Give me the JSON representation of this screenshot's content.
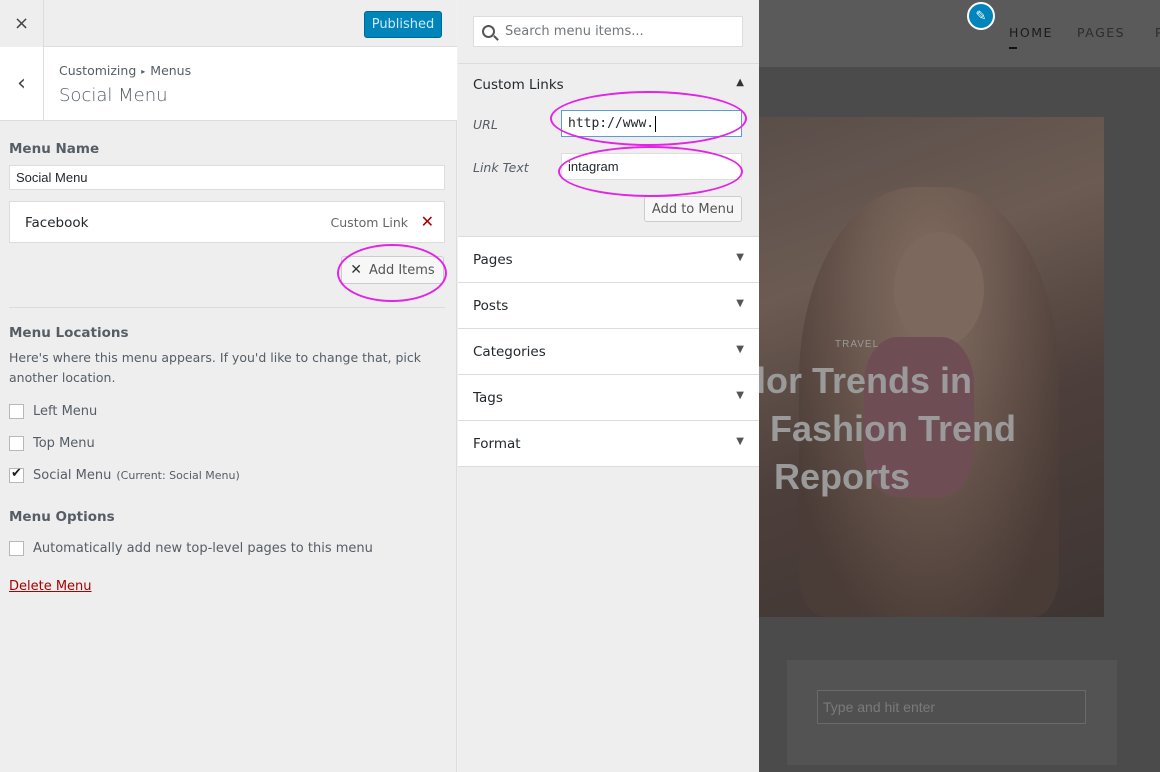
{
  "topbar": {
    "close_icon": "×",
    "publish_label": "Published"
  },
  "section": {
    "back_icon": "‹",
    "breadcrumb_root": "Customizing",
    "breadcrumb_sep": "▸",
    "breadcrumb_parent": "Menus",
    "title": "Social Menu"
  },
  "menu": {
    "name_label": "Menu Name",
    "name_value": "Social Menu",
    "items": [
      {
        "title": "Facebook",
        "type": "Custom Link",
        "remove_icon": "✕"
      }
    ],
    "add_items_icon": "✕",
    "add_items_label": "Add Items"
  },
  "locations": {
    "heading": "Menu Locations",
    "description": "Here's where this menu appears. If you'd like to change that, pick another location.",
    "options": [
      {
        "label": "Left Menu",
        "checked": false
      },
      {
        "label": "Top Menu",
        "checked": false
      },
      {
        "label": "Social Menu",
        "note": "(Current: Social Menu)",
        "checked": true
      }
    ]
  },
  "options": {
    "heading": "Menu Options",
    "auto_add_label": "Automatically add new top-level pages to this menu",
    "delete_label": "Delete Menu"
  },
  "add_panel": {
    "search_placeholder": "Search menu items...",
    "custom_links": {
      "title": "Custom Links",
      "arrow": "▲",
      "url_label": "URL",
      "url_value": "http://www.",
      "link_text_label": "Link Text",
      "link_text_value": "intagram",
      "add_button": "Add to Menu"
    },
    "sections": [
      {
        "title": "Pages",
        "arrow": "▼"
      },
      {
        "title": "Posts",
        "arrow": "▼"
      },
      {
        "title": "Categories",
        "arrow": "▼"
      },
      {
        "title": "Tags",
        "arrow": "▼"
      },
      {
        "title": "Format",
        "arrow": "▼"
      }
    ]
  },
  "preview": {
    "edit_icon": "✎",
    "nav": [
      "HOME",
      "PAGES",
      "P"
    ],
    "post_category": "TRAVEL",
    "post_title_lines": [
      "lor Trends in",
      "Fashion Trend",
      "Reports"
    ],
    "search_placeholder": "Type and hit enter"
  },
  "colors": {
    "accent": "#0085ba",
    "annotation": "#e224e6",
    "delete": "#aa0000"
  }
}
